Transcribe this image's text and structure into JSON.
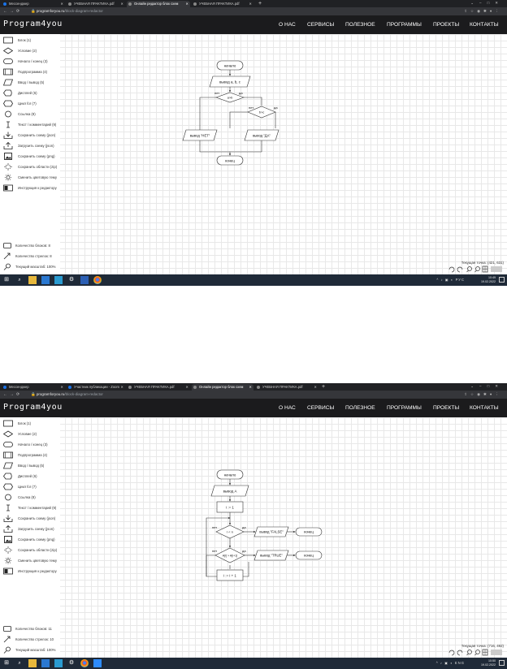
{
  "screens": [
    {
      "tabs": [
        {
          "label": "Мессенджер",
          "active": false
        },
        {
          "label": "УЧЕБНАЯ ПРАКТИКА.pdf",
          "active": false
        },
        {
          "label": "Онлайн редактор блок схем",
          "active": true
        },
        {
          "label": "УЧЕБНАЯ ПРАКТИКА.pdf",
          "active": false
        }
      ],
      "url_host": "programforyou.ru",
      "url_path": "/block-diagram-redactor",
      "site": {
        "logo": "Program4you",
        "menu": [
          "О НАС",
          "СЕРВИСЫ",
          "ПОЛЕЗНОЕ",
          "ПРОГРАММЫ",
          "ПРОЕКТЫ",
          "КОНТАКТЫ"
        ]
      },
      "toolbar": [
        {
          "label": "Блок (1)",
          "icon": "block-icon"
        },
        {
          "label": "Условие (2)",
          "icon": "condition-icon"
        },
        {
          "label": "Начало / конец (3)",
          "icon": "terminator-icon"
        },
        {
          "label": "Подпрограмма (4)",
          "icon": "subprogram-icon"
        },
        {
          "label": "Ввод / вывод (5)",
          "icon": "io-icon"
        },
        {
          "label": "Дисплей (6)",
          "icon": "display-icon"
        },
        {
          "label": "Цикл for (7)",
          "icon": "loop-icon"
        },
        {
          "label": "Ссылка (8)",
          "icon": "link-icon"
        },
        {
          "label": "Текст / комментарий (9)",
          "icon": "text-icon"
        },
        {
          "label": "Сохранить схему (json)",
          "icon": "download-icon"
        },
        {
          "label": "Загрузить схему (json)",
          "icon": "upload-icon"
        },
        {
          "label": "Сохранить схему (png)",
          "icon": "image-icon"
        },
        {
          "label": "Сохранить области (zip)",
          "icon": "area-icon"
        },
        {
          "label": "Сменить цветовую тему",
          "icon": "theme-icon"
        },
        {
          "label": "Инструкция к редактору",
          "icon": "manual-icon"
        }
      ],
      "stats": {
        "blocks": "Количество блоков: 8",
        "arrows": "Количество стрелок: 8",
        "scale": "Текущий масштаб: 100%"
      },
      "coords": "Текущая точка: (421, 631)",
      "tray": {
        "lang": "РУС",
        "time": "10:49",
        "date": "19.02.2022"
      },
      "diagram": {
        "start": "начало",
        "input": "вывод a, b, c",
        "cond1": "a>b",
        "cond2": "b>c",
        "no": "нет",
        "yes": "да",
        "out_no": "вывод \"НЕТ\"",
        "out_yes": "вывод \"ДА\"",
        "end": "конец"
      }
    },
    {
      "tabs": [
        {
          "label": "Мессенджер",
          "active": false
        },
        {
          "label": "Участник публикации - Zoom",
          "active": false
        },
        {
          "label": "УЧЕБНАЯ ПРАКТИКА.pdf",
          "active": false
        },
        {
          "label": "Онлайн редактор блок схем",
          "active": true
        },
        {
          "label": "УЧЕБНАЯ ПРАКТИКА.pdf",
          "active": false
        }
      ],
      "url_host": "programforyou.ru",
      "url_path": "/block-diagram-redactor",
      "site": {
        "logo": "Program4you",
        "menu": [
          "О НАС",
          "СЕРВИСЫ",
          "ПОЛЕЗНОЕ",
          "ПРОГРАММЫ",
          "ПРОЕКТЫ",
          "КОНТАКТЫ"
        ]
      },
      "toolbar": [
        {
          "label": "Блок (1)",
          "icon": "block-icon"
        },
        {
          "label": "Условие (2)",
          "icon": "condition-icon"
        },
        {
          "label": "Начало / конец (3)",
          "icon": "terminator-icon"
        },
        {
          "label": "Подпрограмма (4)",
          "icon": "subprogram-icon"
        },
        {
          "label": "Ввод / вывод (5)",
          "icon": "io-icon"
        },
        {
          "label": "Дисплей (6)",
          "icon": "display-icon"
        },
        {
          "label": "Цикл for (7)",
          "icon": "loop-icon"
        },
        {
          "label": "Ссылка (8)",
          "icon": "link-icon"
        },
        {
          "label": "Текст / комментарий (9)",
          "icon": "text-icon"
        },
        {
          "label": "Сохранить схему (json)",
          "icon": "download-icon"
        },
        {
          "label": "Загрузить схему (json)",
          "icon": "upload-icon"
        },
        {
          "label": "Сохранить схему (png)",
          "icon": "image-icon"
        },
        {
          "label": "Сохранить области (zip)",
          "icon": "area-icon"
        },
        {
          "label": "Сменить цветовую тему",
          "icon": "theme-icon"
        },
        {
          "label": "Инструкция к редактору",
          "icon": "manual-icon"
        }
      ],
      "stats": {
        "blocks": "Количество блоков: 11",
        "arrows": "Количество стрелок: 10",
        "scale": "Текущий масштаб: 100%"
      },
      "coords": "Текущая точка: (716, 492)",
      "tray": {
        "lang": "ENG",
        "time": "10:50",
        "date": "19.02.2022"
      },
      "diagram": {
        "start": "начало",
        "input": "вывод A",
        "init": "i := 1",
        "cond1": "i < n",
        "cond2": "A[i] > A[i+1]",
        "no": "нет",
        "yes": "да",
        "out_false": "вывод \"FALSE\"",
        "out_true": "вывод \"TRUE\"",
        "end1": "конец",
        "end2": "конец",
        "incr": "i := i + 1"
      }
    }
  ]
}
